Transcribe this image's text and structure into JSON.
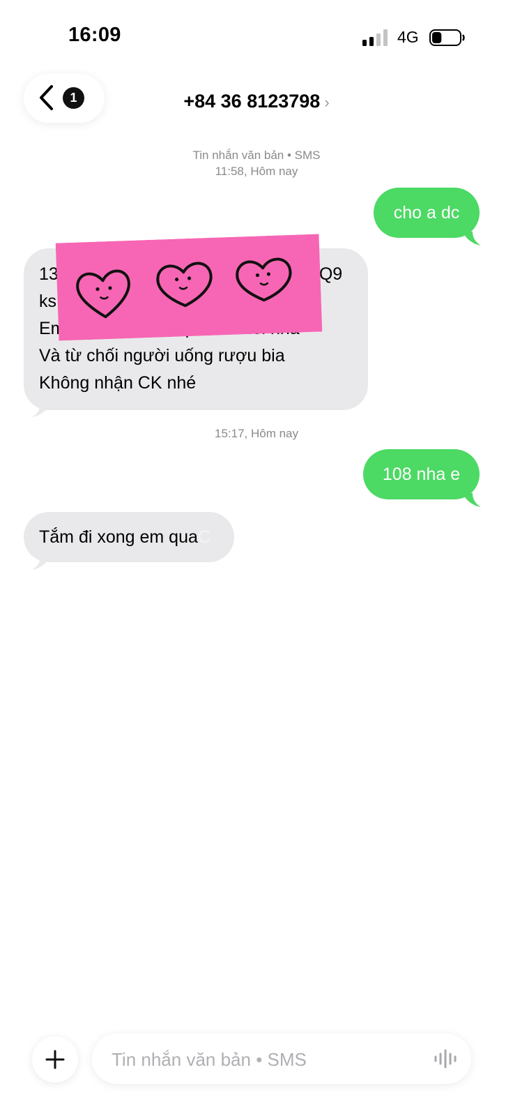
{
  "status_bar": {
    "time": "16:09",
    "network": "4G",
    "signal_bars": 2,
    "battery_level": 0.35
  },
  "header": {
    "back_badge": "1",
    "contact": "+84 36 8123798",
    "chevron": "›"
  },
  "thread": {
    "service_label": "Tin nhắn văn bản • SMS",
    "stamp1": "11:58, Hôm nay",
    "stamp2": "15:17, Hôm nay",
    "messages": [
      {
        "direction": "out",
        "text": "cho a dc"
      },
      {
        "direction": "in",
        "lines": [
          {
            "prefix": "13",
            "suffix": "Q9"
          },
          {
            "prefix": "ks"
          },
          "Em từ chối người quá 50 tuổi nha",
          "Và từ chối người uống rượu bia",
          "Không nhận CK nhé"
        ],
        "sticker": "pink-heart-faces-sticker"
      },
      {
        "direction": "out",
        "text": "108 nha e"
      },
      {
        "direction": "in",
        "text": "Tắm đi xong em qua",
        "faded_suffix": "C"
      }
    ]
  },
  "composer": {
    "plus_icon": "plus-icon",
    "placeholder": "Tin nhắn văn bản • SMS",
    "value": "",
    "mic_icon": "waveform-icon"
  },
  "colors": {
    "outgoing_bubble": "#4cd964",
    "incoming_bubble": "#e9e9eb",
    "sticker_pink": "#f766b4",
    "timestamp_text": "#8a8a8e"
  }
}
